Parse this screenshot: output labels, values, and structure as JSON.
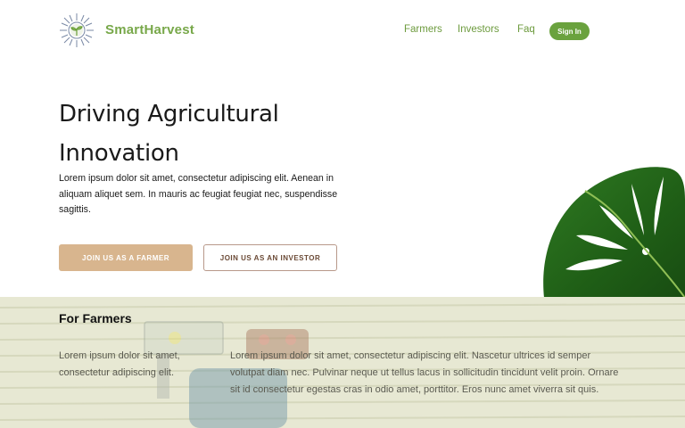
{
  "header": {
    "brand": "SmartHarvest",
    "logo_icon": "sun-sprout-logo",
    "nav": {
      "farmers": "Farmers",
      "investors": "Investors",
      "faq": "Faq"
    },
    "signin_label": "Sign In"
  },
  "hero": {
    "title": "Driving Agricultural Innovation",
    "text": "Lorem ipsum dolor sit amet, consectetur adipiscing elit. Aenean in aliquam aliquet sem. In mauris ac feugiat feugiat nec, suspendisse sagittis.",
    "buttons": {
      "farmer": "JOIN US AS A FARMER",
      "investor": "JOIN US AS AN INVESTOR"
    },
    "decoration": "monstera-leaf"
  },
  "farmers_section": {
    "title": "For Farmers",
    "intro": "Lorem ipsum dolor sit amet, consectetur adipiscing elit.",
    "body": "Lorem ipsum dolor sit amet, consectetur adipiscing elit. Nascetur ultrices id semper volutpat diam nec. Pulvinar neque ut tellus lacus in sollicitudin tincidunt velit proin. Ornare sit id consectetur egestas cras in odio amet, porttitor. Eros nunc amet viverra sit quis."
  },
  "colors": {
    "brand_green": "#78a84a",
    "signin_green": "#6aa23e",
    "farmer_button": "#d8b58e",
    "investor_border": "#b8998a"
  }
}
